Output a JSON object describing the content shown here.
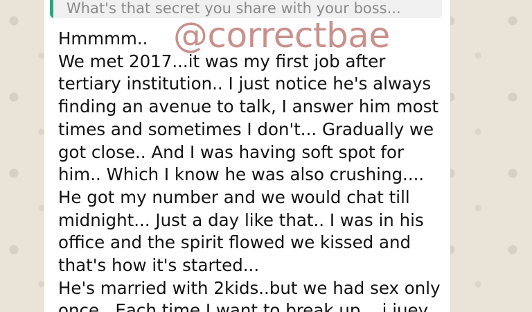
{
  "chat": {
    "quoted_message": "What's that secret you share with your boss...",
    "watermark": "@correctbae",
    "message_lines": [
      "Hmmmm..",
      "We met 2017...it was my first job after",
      "tertiary institution.. I just notice he's always",
      "finding an avenue to talk, I answer him most",
      "times and sometimes I don't... Gradually we",
      "got close.. And I was having soft spot for",
      "him.. Which I know he was also crushing....",
      "He got my number and we would chat till",
      "midnight... Just a day like that.. I was in his",
      "office and the spirit flowed we kissed and",
      "that's how it's started...",
      "He's married with 2kids..but we had sex only",
      "once.. Each time I want to break up... i juey"
    ]
  },
  "colors": {
    "quote_accent": "#25a884",
    "watermark": "#c9908c",
    "background": "#e9e3d8"
  }
}
